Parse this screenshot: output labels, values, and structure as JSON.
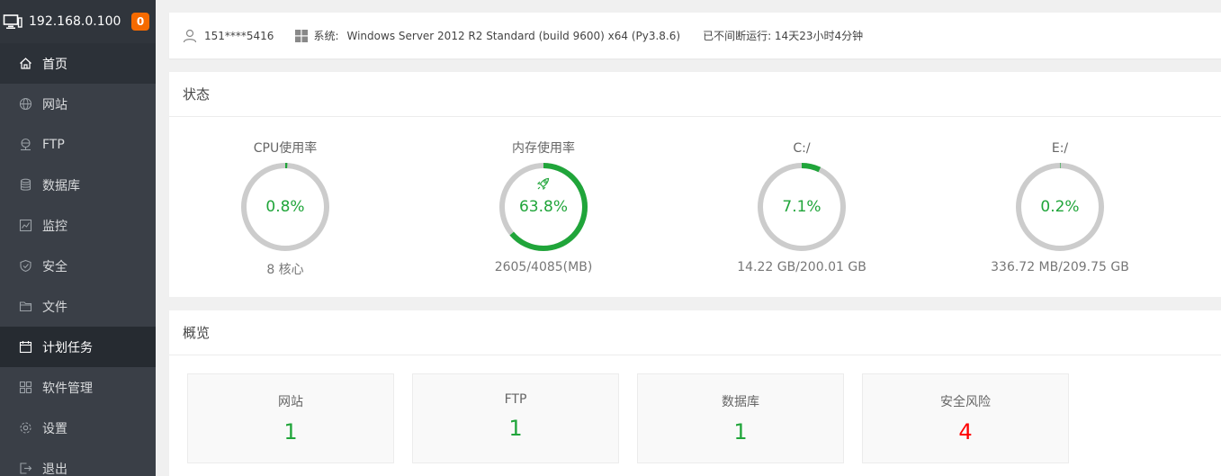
{
  "sidebar": {
    "ip": "192.168.0.100",
    "badge": "0",
    "items": [
      {
        "label": "首页",
        "icon": "home-icon"
      },
      {
        "label": "网站",
        "icon": "globe-icon"
      },
      {
        "label": "FTP",
        "icon": "ftp-icon"
      },
      {
        "label": "数据库",
        "icon": "database-icon"
      },
      {
        "label": "监控",
        "icon": "monitor-chart-icon"
      },
      {
        "label": "安全",
        "icon": "shield-icon"
      },
      {
        "label": "文件",
        "icon": "folder-icon"
      },
      {
        "label": "计划任务",
        "icon": "calendar-icon"
      },
      {
        "label": "软件管理",
        "icon": "grid-icon"
      },
      {
        "label": "设置",
        "icon": "gear-icon"
      },
      {
        "label": "退出",
        "icon": "logout-icon"
      }
    ]
  },
  "info": {
    "user": "151****5416",
    "sys_label": "系统:",
    "sys_value": "Windows Server 2012 R2 Standard (build 9600) x64 (Py3.8.6)",
    "uptime": "已不间断运行: 14天23小时4分钟"
  },
  "status": {
    "title": "状态",
    "gauges": [
      {
        "title": "CPU使用率",
        "value": "0.8%",
        "percent": 0.8,
        "sub": "8 核心"
      },
      {
        "title": "内存使用率",
        "value": "63.8%",
        "percent": 63.8,
        "sub": "2605/4085(MB)"
      },
      {
        "title": "C:/",
        "value": "7.1%",
        "percent": 7.1,
        "sub": "14.22 GB/200.01 GB"
      },
      {
        "title": "E:/",
        "value": "0.2%",
        "percent": 0.2,
        "sub": "336.72 MB/209.75 GB"
      }
    ]
  },
  "overview": {
    "title": "概览",
    "cards": [
      {
        "label": "网站",
        "value": "1"
      },
      {
        "label": "FTP",
        "value": "1"
      },
      {
        "label": "数据库",
        "value": "1"
      },
      {
        "label": "安全风险",
        "value": "4"
      }
    ]
  },
  "colors": {
    "accent": "#20a53a",
    "danger": "#ff0000",
    "ring_bg": "#cccccc",
    "sidebar_bg": "#3a3f47"
  }
}
